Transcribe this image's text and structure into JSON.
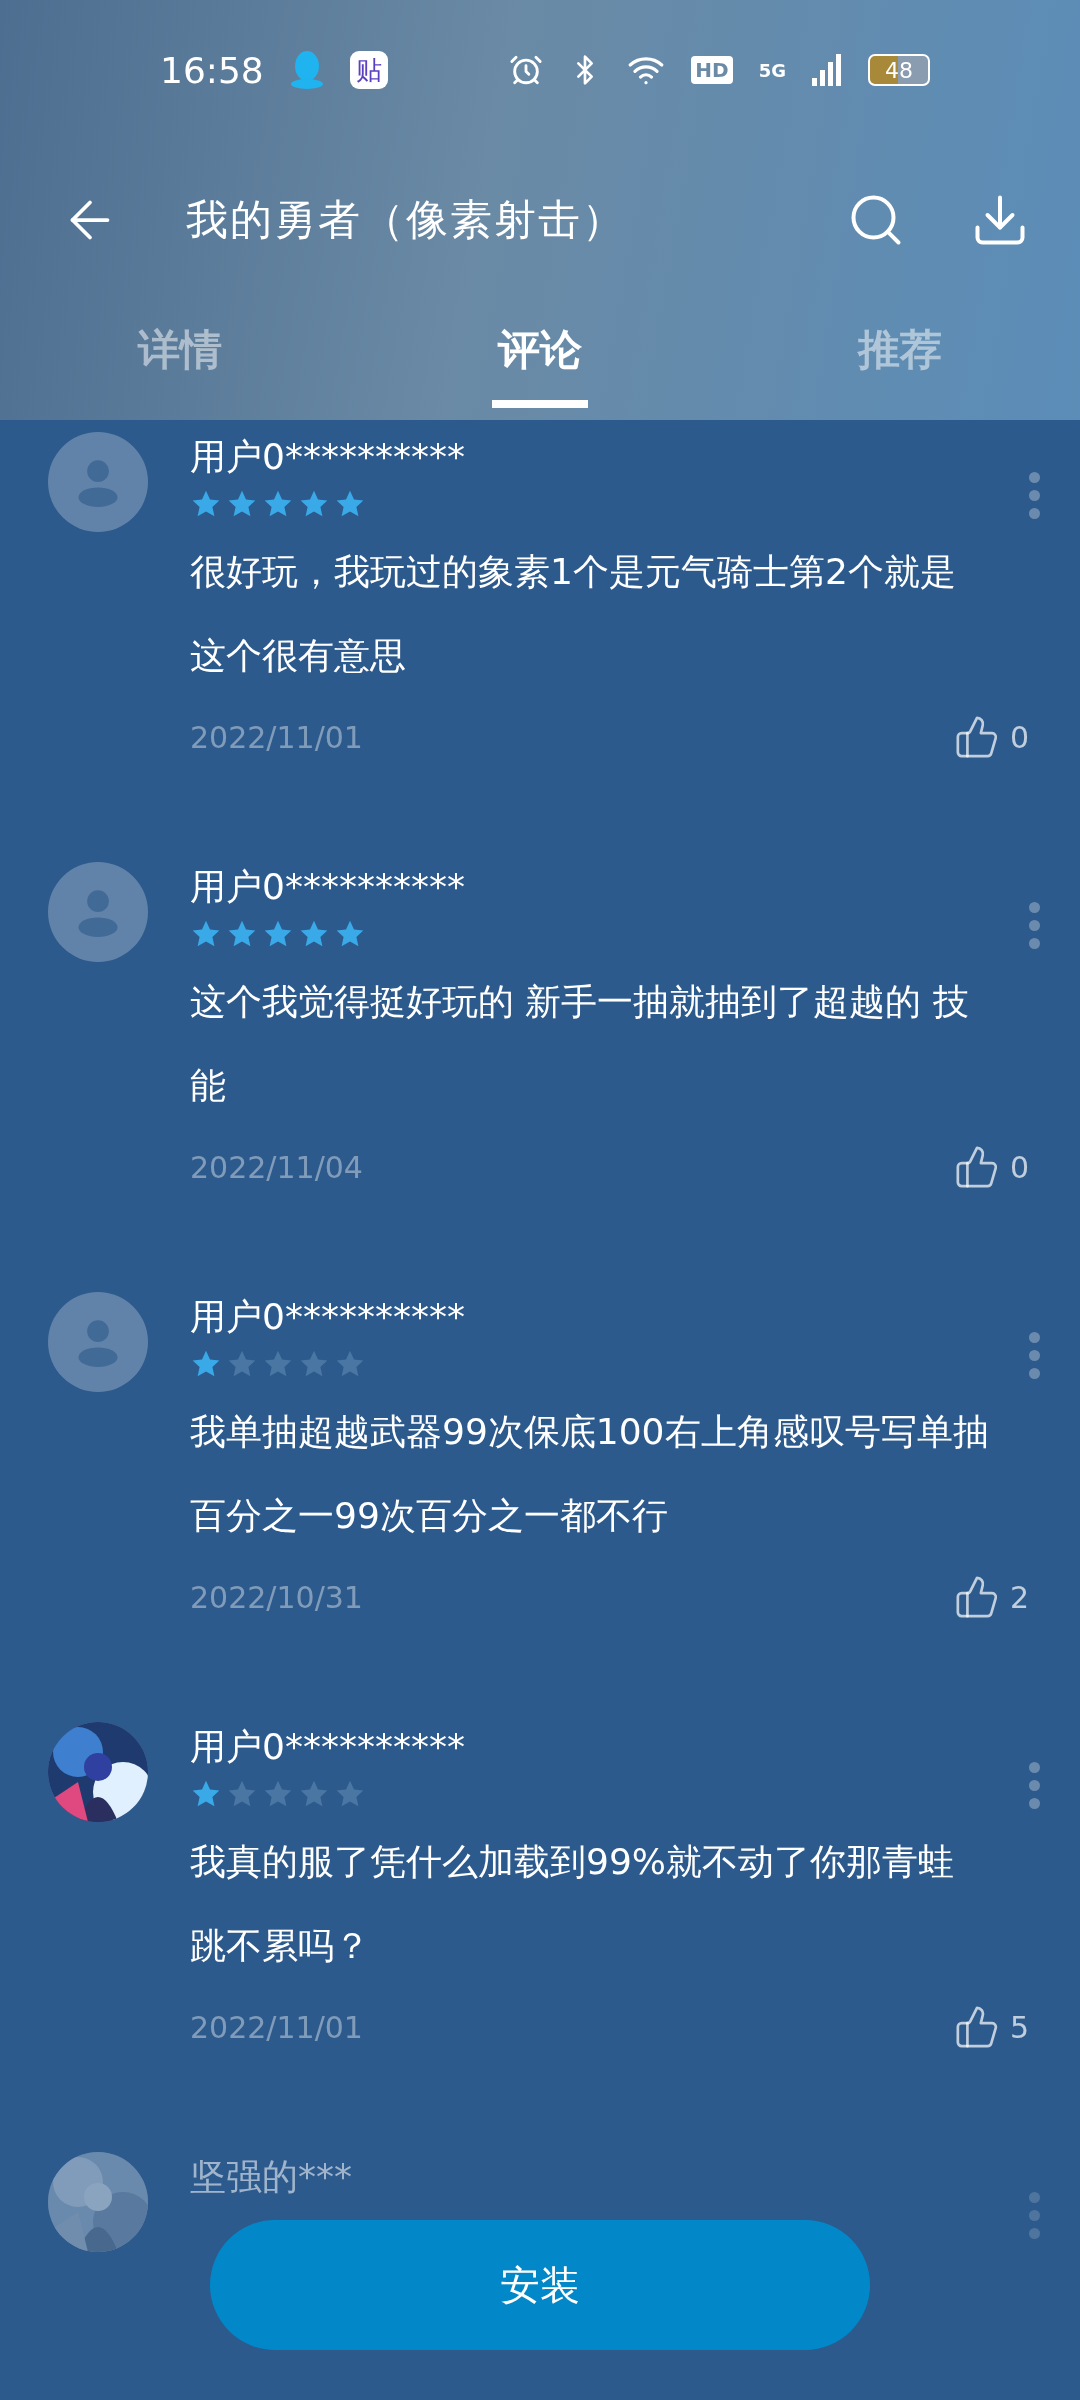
{
  "status_bar": {
    "time": "16:58",
    "app_badge": "贴",
    "battery": "48",
    "network": "5G",
    "hd": "HD"
  },
  "header": {
    "title": "我的勇者（像素射击）"
  },
  "tabs": [
    {
      "label": "详情",
      "selected": false
    },
    {
      "label": "评论",
      "selected": true
    },
    {
      "label": "推荐",
      "selected": false
    }
  ],
  "comments": [
    {
      "user": "用户0**********",
      "avatar": {
        "kind": "default"
      },
      "stars": 5,
      "text": "很好玩，我玩过的象素1个是元气骑士第2个就是这个很有意思",
      "date": "2022/11/01",
      "likes": "0"
    },
    {
      "user": "用户0**********",
      "avatar": {
        "kind": "default"
      },
      "stars": 5,
      "text": "这个我觉得挺好玩的 新手一抽就抽到了超越的 技能",
      "date": "2022/11/04",
      "likes": "0"
    },
    {
      "user": "用户0**********",
      "avatar": {
        "kind": "default"
      },
      "stars": 1,
      "text": "我单抽超越武器99次保底100右上角感叹号写单抽百分之一99次百分之一都不行",
      "date": "2022/10/31",
      "likes": "2"
    },
    {
      "user": "用户0**********",
      "stars": 1,
      "text": "我真的服了凭什么加载到99%就不动了你那青蛙跳不累吗？",
      "date": "2022/11/01",
      "likes": "5"
    },
    {
      "user": "坚强的***"
    }
  ],
  "install_button": {
    "label": "安装"
  }
}
